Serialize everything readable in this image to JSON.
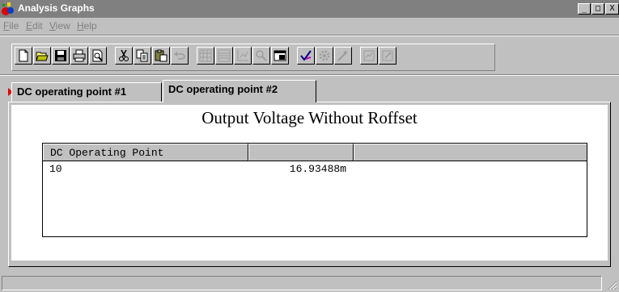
{
  "window": {
    "title": "Analysis Graphs",
    "controls": {
      "minimize": "_",
      "maximize": "□",
      "close": "X"
    }
  },
  "menu": [
    {
      "label": "File",
      "accel": "F",
      "rest": "ile"
    },
    {
      "label": "Edit",
      "accel": "E",
      "rest": "dit"
    },
    {
      "label": "View",
      "accel": "V",
      "rest": "iew"
    },
    {
      "label": "Help",
      "accel": "H",
      "rest": "elp"
    }
  ],
  "toolbar": {
    "buttons": [
      {
        "icon": "new-document-icon",
        "enabled": true
      },
      {
        "icon": "open-folder-icon",
        "enabled": true
      },
      {
        "icon": "save-disk-icon",
        "enabled": true
      },
      {
        "icon": "printer-icon",
        "enabled": true
      },
      {
        "icon": "print-preview-icon",
        "enabled": true
      },
      {
        "icon": "cut-icon",
        "enabled": true
      },
      {
        "icon": "copy-icon",
        "enabled": true
      },
      {
        "icon": "paste-icon",
        "enabled": true
      },
      {
        "icon": "undo-icon",
        "enabled": false
      },
      {
        "icon": "grid-icon",
        "enabled": false
      },
      {
        "icon": "table-icon",
        "enabled": false
      },
      {
        "icon": "axis-icon",
        "enabled": false
      },
      {
        "icon": "zoom-icon",
        "enabled": false
      },
      {
        "icon": "window-icon",
        "enabled": true
      },
      {
        "icon": "check-icon",
        "enabled": true
      },
      {
        "icon": "gear-icon",
        "enabled": false
      },
      {
        "icon": "wand-icon",
        "enabled": false
      },
      {
        "icon": "chart-icon",
        "enabled": false
      },
      {
        "icon": "chart-edit-icon",
        "enabled": false
      }
    ]
  },
  "tabs": [
    {
      "label": "DC operating point #1",
      "active": false
    },
    {
      "label": "DC operating point #2",
      "active": true
    }
  ],
  "graph": {
    "title": "Output Voltage Without Roffset",
    "columns": [
      "DC Operating Point",
      "",
      ""
    ],
    "rows": [
      {
        "col1": "10",
        "col2": "16.93488m",
        "col3": ""
      }
    ]
  },
  "colors": {
    "title_bar": "#808080",
    "face": "#c0c0c0",
    "tab_marker": "#e00000"
  }
}
